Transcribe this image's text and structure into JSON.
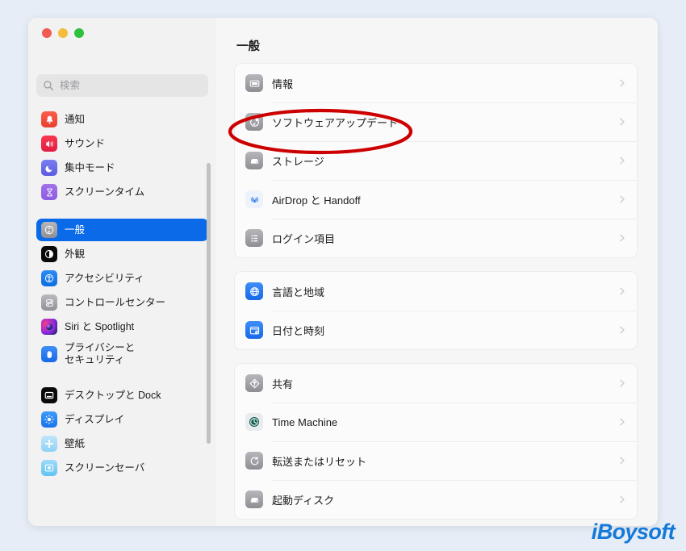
{
  "window": {
    "title": "一般",
    "traffic_lights": [
      "close",
      "minimize",
      "maximize"
    ]
  },
  "search": {
    "placeholder": "検索",
    "value": ""
  },
  "sidebar": {
    "groups": [
      {
        "items": [
          {
            "label": "通知",
            "icon": "notifications-icon",
            "selected": false
          },
          {
            "label": "サウンド",
            "icon": "sound-icon",
            "selected": false
          },
          {
            "label": "集中モード",
            "icon": "focus-icon",
            "selected": false
          },
          {
            "label": "スクリーンタイム",
            "icon": "screen-time-icon",
            "selected": false
          }
        ]
      },
      {
        "items": [
          {
            "label": "一般",
            "icon": "general-icon",
            "selected": true
          },
          {
            "label": "外観",
            "icon": "appearance-icon",
            "selected": false
          },
          {
            "label": "アクセシビリティ",
            "icon": "accessibility-icon",
            "selected": false
          },
          {
            "label": "コントロールセンター",
            "icon": "control-center-icon",
            "selected": false
          },
          {
            "label": "Siri と Spotlight",
            "icon": "siri-icon",
            "selected": false
          },
          {
            "label": "プライバシーと\nセキュリティ",
            "icon": "privacy-icon",
            "selected": false,
            "tall": true
          }
        ]
      },
      {
        "items": [
          {
            "label": "デスクトップと Dock",
            "icon": "desktop-dock-icon",
            "selected": false
          },
          {
            "label": "ディスプレイ",
            "icon": "display-icon",
            "selected": false
          },
          {
            "label": "壁紙",
            "icon": "wallpaper-icon",
            "selected": false
          },
          {
            "label": "スクリーンセーバ",
            "icon": "screensaver-icon",
            "selected": false
          }
        ]
      }
    ]
  },
  "main": {
    "title": "一般",
    "cards": [
      {
        "rows": [
          {
            "label": "情報",
            "icon": "about-icon",
            "chevron": "chevron-right-icon"
          },
          {
            "label": "ソフトウェアアップデート",
            "icon": "software-update-icon",
            "chevron": "chevron-right-icon"
          },
          {
            "label": "ストレージ",
            "icon": "storage-icon",
            "chevron": "chevron-right-icon"
          },
          {
            "label": "AirDrop と Handoff",
            "icon": "airdrop-icon",
            "chevron": "chevron-right-icon"
          },
          {
            "label": "ログイン項目",
            "icon": "login-items-icon",
            "chevron": "chevron-right-icon"
          }
        ]
      },
      {
        "rows": [
          {
            "label": "言語と地域",
            "icon": "language-region-icon",
            "chevron": "chevron-right-icon"
          },
          {
            "label": "日付と時刻",
            "icon": "date-time-icon",
            "chevron": "chevron-right-icon"
          }
        ]
      },
      {
        "rows": [
          {
            "label": "共有",
            "icon": "sharing-icon",
            "chevron": "chevron-right-icon"
          },
          {
            "label": "Time Machine",
            "icon": "time-machine-icon",
            "chevron": "chevron-right-icon"
          },
          {
            "label": "転送またはリセット",
            "icon": "transfer-reset-icon",
            "chevron": "chevron-right-icon"
          },
          {
            "label": "起動ディスク",
            "icon": "startup-disk-icon",
            "chevron": "chevron-right-icon"
          }
        ]
      }
    ]
  },
  "annotation": {
    "shape": "ellipse",
    "color": "#cc0000",
    "target": "ソフトウェアアップデート"
  },
  "watermark": {
    "text": "iBoysoft",
    "color": "#1479d9"
  },
  "colors": {
    "selection_blue": "#0b6ae8",
    "page_background": "#e6edf7",
    "window_background": "#f6f6f6",
    "annotation_red": "#cc0000"
  }
}
